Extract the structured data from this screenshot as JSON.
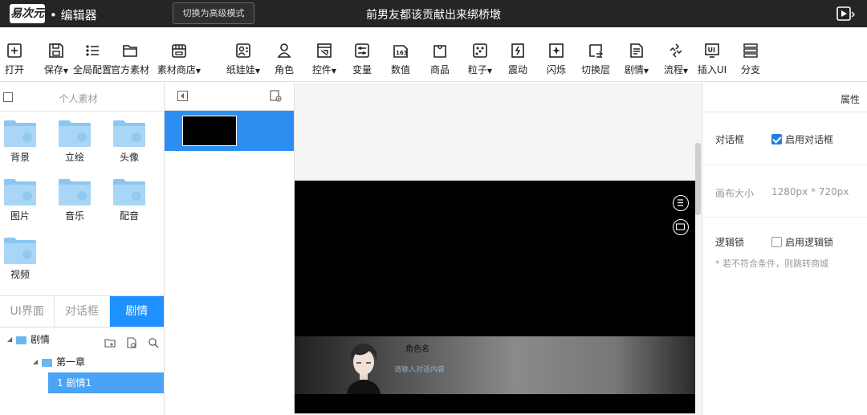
{
  "titlebar": {
    "logo_text": "易次元",
    "app_name": "• 编辑器",
    "mode_button": "切换为高级模式",
    "doc_title": "前男友都该贡献出来绑桥墩"
  },
  "toolbar": {
    "items": [
      {
        "label": "打开",
        "icon": "plus-box-icon",
        "caret": false
      },
      {
        "label": "保存",
        "icon": "save-icon",
        "caret": true
      },
      {
        "label": "全局配置",
        "icon": "list-icon",
        "caret": false
      },
      {
        "label": "官方素材",
        "icon": "folder-icon",
        "caret": false
      },
      {
        "label": "素材商店",
        "icon": "store-icon",
        "caret": true
      },
      {
        "label": "纸娃娃",
        "icon": "doll-icon",
        "caret": true
      },
      {
        "label": "角色",
        "icon": "person-icon",
        "caret": false
      },
      {
        "label": "控件",
        "icon": "widget-icon",
        "caret": true
      },
      {
        "label": "变量",
        "icon": "sliders-icon",
        "caret": false
      },
      {
        "label": "数值",
        "icon": "number-icon",
        "caret": false
      },
      {
        "label": "商品",
        "icon": "bag-icon",
        "caret": false
      },
      {
        "label": "粒子",
        "icon": "particle-icon",
        "caret": true
      },
      {
        "label": "震动",
        "icon": "shake-icon",
        "caret": false
      },
      {
        "label": "闪烁",
        "icon": "flash-icon",
        "caret": false
      },
      {
        "label": "切换层",
        "icon": "layer-switch-icon",
        "caret": false
      },
      {
        "label": "剧情",
        "icon": "document-icon",
        "caret": true
      },
      {
        "label": "流程",
        "icon": "flow-icon",
        "caret": true
      },
      {
        "label": "插入UI",
        "icon": "ui-icon",
        "caret": false
      },
      {
        "label": "分支",
        "icon": "branch-icon",
        "caret": false
      }
    ]
  },
  "left_panel": {
    "title": "个人素材",
    "folders": [
      "背景",
      "立绘",
      "头像",
      "图片",
      "音乐",
      "配音",
      "视频"
    ],
    "tabs": [
      "UI界面",
      "对话框",
      "剧情"
    ],
    "active_tab": "剧情",
    "tree": {
      "root": "剧情",
      "chapter": "第一章",
      "item": "1 剧情1"
    }
  },
  "canvas": {
    "character_name": "角色名",
    "dialog_text": "请输入对话内容"
  },
  "properties": {
    "header": "属性",
    "dialog_label": "对话框",
    "dialog_checkbox": "启用对话框",
    "dialog_checked": true,
    "canvas_size_label": "画布大小",
    "canvas_size_value": "1280px * 720px",
    "logic_lock_label": "逻辑锁",
    "logic_lock_checkbox": "启用逻辑锁",
    "logic_lock_checked": false,
    "logic_lock_note": "* 若不符合条件，则跳转商城"
  },
  "colors": {
    "accent": "#1e90ff",
    "titlebar_bg": "#252525",
    "folder": "#8cc6f0"
  }
}
